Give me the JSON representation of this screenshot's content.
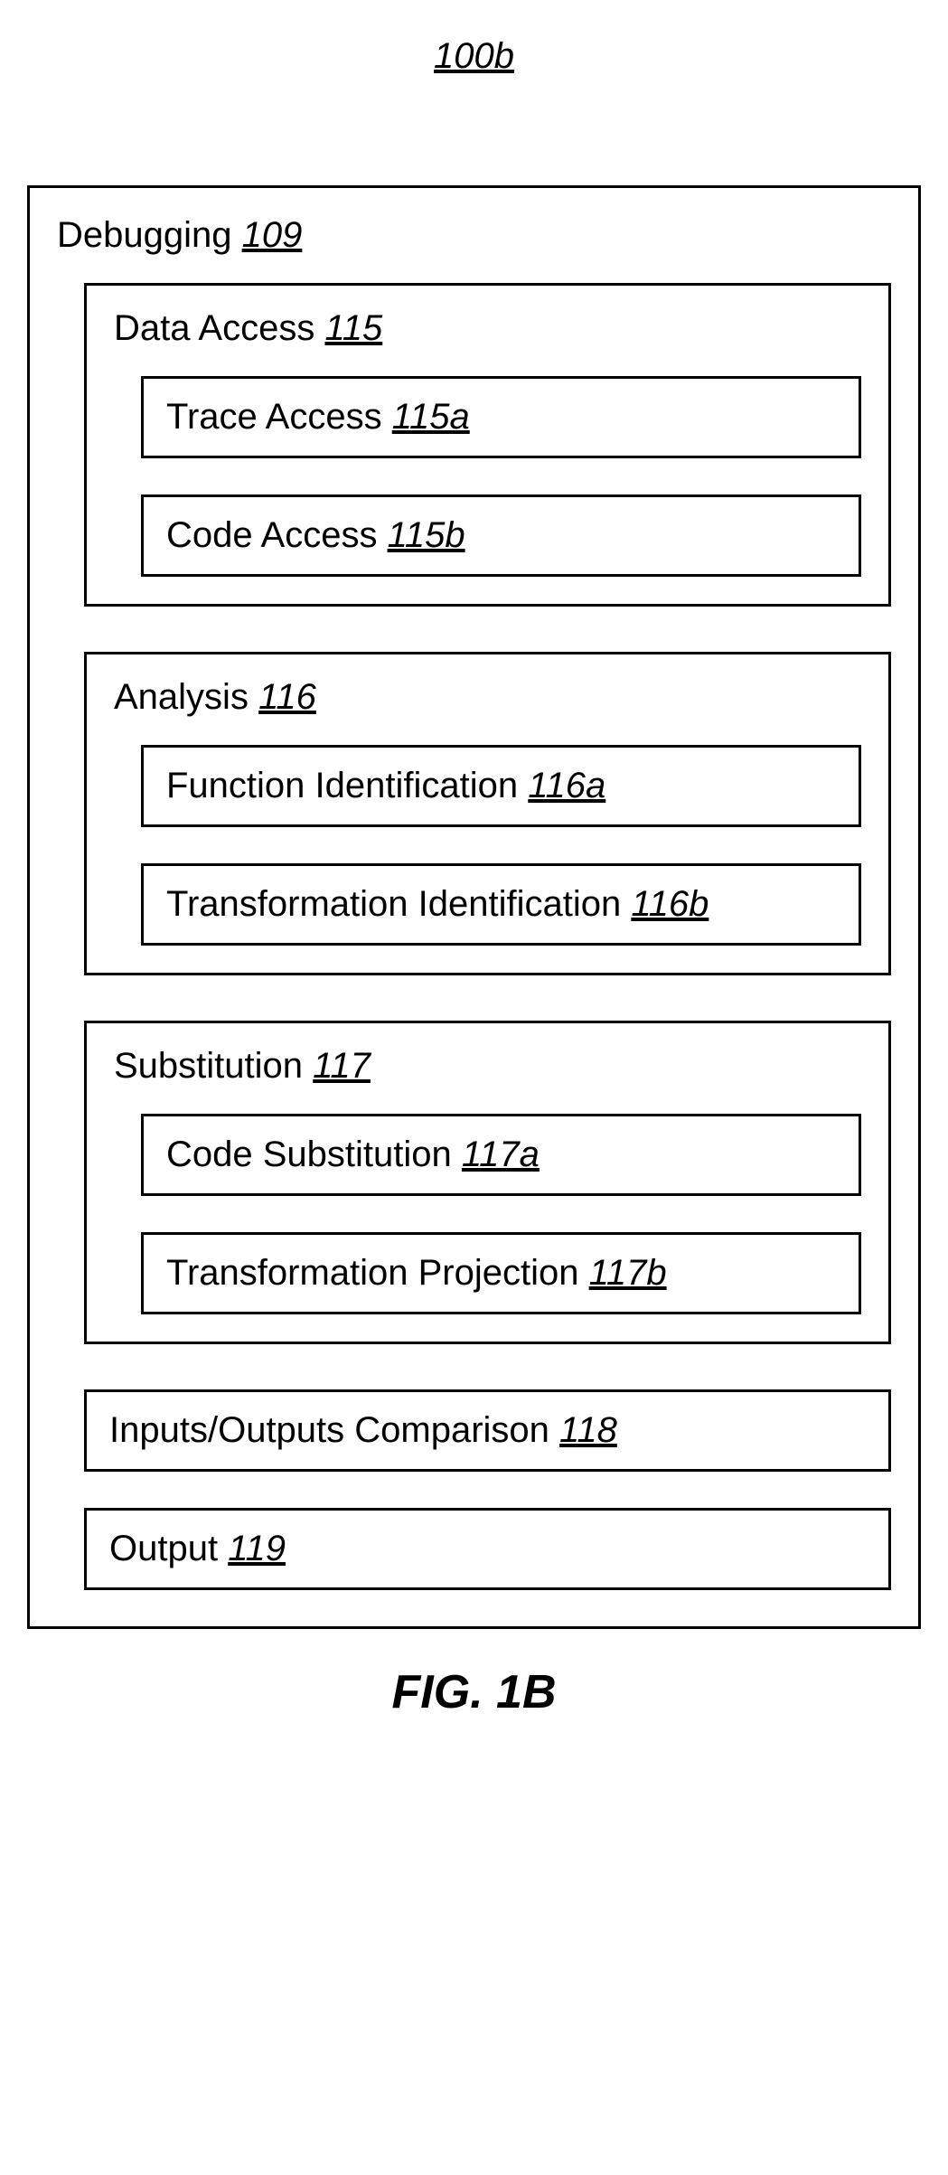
{
  "topLabel": "100b",
  "outer": {
    "title": "Debugging",
    "ref": "109"
  },
  "sections": [
    {
      "title": "Data Access",
      "ref": "115",
      "items": [
        {
          "title": "Trace Access",
          "ref": "115a"
        },
        {
          "title": "Code Access",
          "ref": "115b"
        }
      ]
    },
    {
      "title": "Analysis",
      "ref": "116",
      "items": [
        {
          "title": "Function Identification",
          "ref": "116a"
        },
        {
          "title": "Transformation Identification",
          "ref": "116b"
        }
      ]
    },
    {
      "title": "Substitution",
      "ref": "117",
      "items": [
        {
          "title": "Code Substitution",
          "ref": "117a"
        },
        {
          "title": "Transformation Projection",
          "ref": "117b"
        }
      ]
    }
  ],
  "simpleBoxes": [
    {
      "title": "Inputs/Outputs Comparison",
      "ref": "118"
    },
    {
      "title": "Output",
      "ref": "119"
    }
  ],
  "bottomLabel": "FIG. 1B"
}
